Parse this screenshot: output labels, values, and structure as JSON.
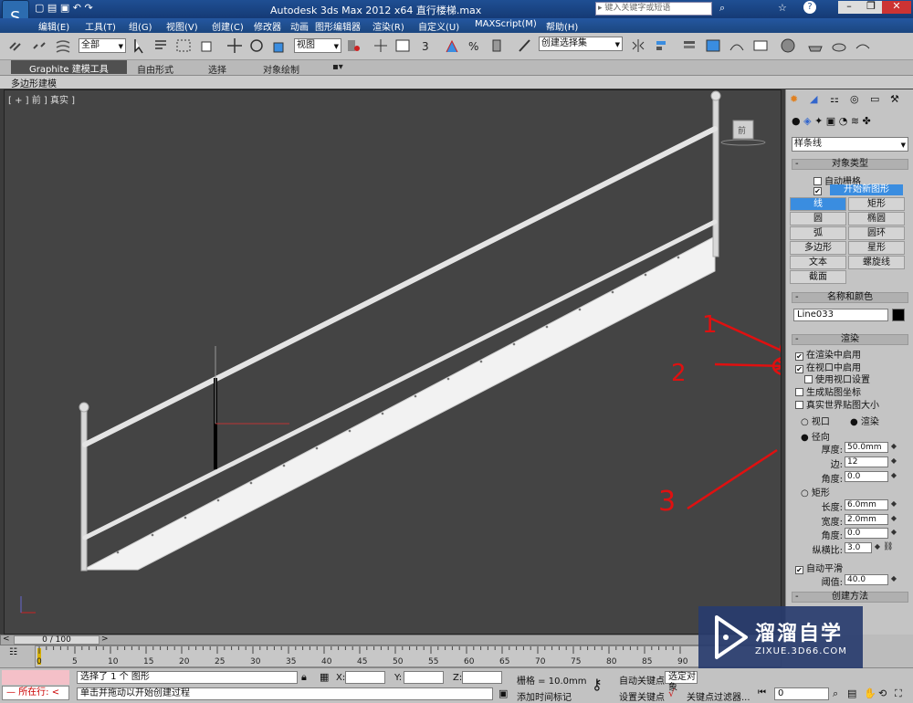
{
  "title_bar": {
    "title": "Autodesk 3ds Max  2012 x64     直行楼梯.max",
    "search_placeholder": "键入关键字或短语"
  },
  "menu": [
    "编辑(E)",
    "工具(T)",
    "组(G)",
    "视图(V)",
    "创建(C)",
    "修改器",
    "动画",
    "图形编辑器",
    "渲染(R)",
    "自定义(U)",
    "MAXScript(M)",
    "帮助(H)"
  ],
  "toolbar": {
    "filter_select": "全部",
    "view_select": "视图",
    "selection_set": "创建选择集"
  },
  "ribbon": {
    "tabs": [
      "Graphite 建模工具",
      "自由形式",
      "选择",
      "对象绘制"
    ],
    "sub": "多边形建模"
  },
  "viewport": {
    "label": "[ + ] 前 ] 真实 ]",
    "viewcube_label": "前"
  },
  "command_panel": {
    "category": "样条线",
    "object_type": {
      "header": "对象类型",
      "auto_grid": "自动栅格",
      "start_new_shape": "开始新图形",
      "buttons": [
        "线",
        "矩形",
        "圆",
        "椭圆",
        "弧",
        "圆环",
        "多边形",
        "星形",
        "文本",
        "螺旋线",
        "截面"
      ]
    },
    "name_color": {
      "header": "名称和颜色",
      "name": "Line033"
    },
    "rendering": {
      "header": "渲染",
      "enable_in_renderer": "在渲染中启用",
      "enable_in_viewport": "在视口中启用",
      "use_viewport_settings": "使用视口设置",
      "gen_mapping": "生成贴图坐标",
      "real_world": "真实世界贴图大小",
      "viewport_radio": "视口",
      "render_radio": "渲染",
      "radial": "径向",
      "thickness_label": "厚度:",
      "thickness": "50.0mm",
      "sides_label": "边:",
      "sides": "12",
      "angle_label": "角度:",
      "angle": "0.0",
      "rectangular": "矩形",
      "length_label": "长度:",
      "length": "6.0mm",
      "width_label": "宽度:",
      "width": "2.0mm",
      "angle2_label": "角度:",
      "angle2": "0.0",
      "aspect_label": "纵横比:",
      "aspect": "3.0",
      "auto_smooth": "自动平滑",
      "threshold_label": "阈值:",
      "threshold": "40.0"
    },
    "creation_method": "创建方法"
  },
  "annotations": [
    "1",
    "2",
    "3"
  ],
  "timeline": {
    "frame": "0 / 100",
    "ticks": [
      "0",
      "5",
      "10",
      "15",
      "20",
      "25",
      "30",
      "35",
      "40",
      "45",
      "50",
      "55",
      "60",
      "65",
      "70",
      "75",
      "80",
      "85",
      "90"
    ]
  },
  "status": {
    "selected": "选择了 1 个 图形",
    "prompt": "单击并拖动以开始创建过程",
    "mini_listener": "所在行:",
    "x_label": "X:",
    "y_label": "Y:",
    "z_label": "Z:",
    "grid": "栅格 = 10.0mm",
    "add_time_tag": "添加时间标记",
    "auto_key": "自动关键点",
    "auto_key_select": "选定对象",
    "set_key": "设置关键点",
    "key_filters": "关键点过滤器...",
    "frame_field": "0"
  },
  "watermark": {
    "title": "溜溜自学",
    "url": "ZIXUE.3D66.COM"
  },
  "colors": {
    "accent": "#3a8de0",
    "annotation": "#e01010"
  }
}
